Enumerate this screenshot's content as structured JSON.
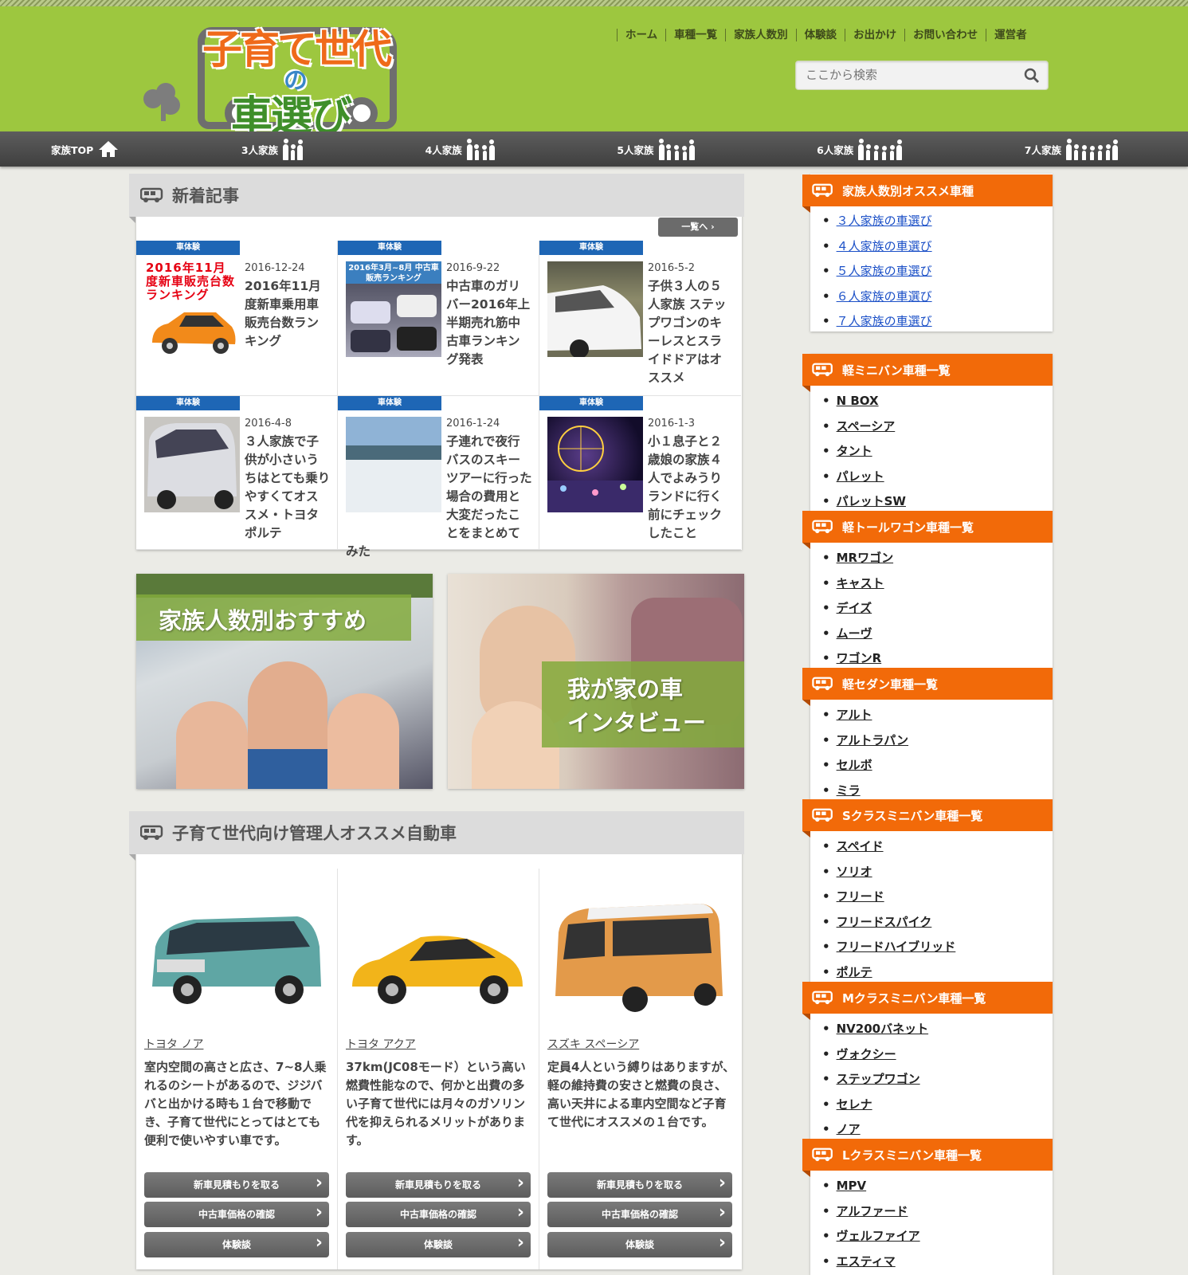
{
  "header": {
    "logo": {
      "line1": "子育て世代",
      "line2": "の",
      "line3": "車選び"
    },
    "nav": [
      "ホーム",
      "車種一覧",
      "家族人数別",
      "体験談",
      "お出かけ",
      "お問い合わせ",
      "運営者"
    ],
    "search_placeholder": "ここから検索"
  },
  "family_nav": [
    {
      "label": "家族TOP",
      "icon": "home-icon"
    },
    {
      "label": "3人家族",
      "icon": "family-3-icon"
    },
    {
      "label": "4人家族",
      "icon": "family-4-icon"
    },
    {
      "label": "5人家族",
      "icon": "family-5-icon"
    },
    {
      "label": "6人家族",
      "icon": "family-6-icon"
    },
    {
      "label": "7人家族",
      "icon": "family-7-icon"
    }
  ],
  "news": {
    "title": "新着記事",
    "more": "一覧へ",
    "items": [
      {
        "tag": "車体験",
        "date": "2016-12-24",
        "title": "2016年11月度新車乗用車販売台数ランキング",
        "thumb_text": "2016年11月度新車販売台数ランキング"
      },
      {
        "tag": "車体験",
        "date": "2016-9-22",
        "title": "中古車のガリバー2016年上半期売れ筋中古車ランキング発表",
        "thumb_text": "2016年3月~8月 中古車販売ランキング"
      },
      {
        "tag": "車体験",
        "date": "2016-5-2",
        "title": "子供３人の５人家族 ステップワゴンのキーレスとスライドドアはオススメ"
      },
      {
        "tag": "車体験",
        "date": "2016-4-8",
        "title": "３人家族で子供が小さいうちはとても乗りやすくてオススメ・トヨタポルテ"
      },
      {
        "tag": "車体験",
        "date": "2016-1-24",
        "title": "子連れで夜行バスのスキーツアーに行った場合の費用と大変だったことをまとめてみた"
      },
      {
        "tag": "車体験",
        "date": "2016-1-3",
        "title": "小１息子と２歳娘の家族４人でよみうりランドに行く前にチェックしたこと"
      }
    ]
  },
  "banners": [
    {
      "title": "家族人数別おすすめ"
    },
    {
      "title_line1": "我が家の車",
      "title_line2": "インタビュー"
    }
  ],
  "recommend": {
    "title": "子育て世代向け管理人オススメ自動車",
    "cars": [
      {
        "name": "トヨタ ノア",
        "desc": "室内空間の高さと広さ、7~8人乗れるのシートがあるので、ジジババと出かける時も１台で移動でき、子育て世代にとってはとても便利で使いやすい車です。",
        "color": "#5fa6a4"
      },
      {
        "name": "トヨタ アクア",
        "desc": "37km(JC08モード）という高い燃費性能なので、何かと出費の多い子育て世代には月々のガソリン代を抑えられるメリットがあります。",
        "color": "#f2b41a"
      },
      {
        "name": "スズキ スペーシア",
        "desc": "定員4人という縛りはありますが、軽の維持費の安さと燃費の良さ、高い天井による車内空間など子育て世代にオススメの１台です。",
        "color": "#e39a4a"
      }
    ],
    "buttons": [
      "新車見積もりを取る",
      "中古車価格の確認",
      "体験談"
    ]
  },
  "sidebar": [
    {
      "title": "家族人数別オススメ車種",
      "items": [
        "３人家族の車選び",
        "４人家族の車選び",
        "５人家族の車選び",
        "６人家族の車選び",
        "７人家族の車選び"
      ]
    },
    {
      "title": "軽ミニバン車種一覧",
      "items": [
        "N BOX",
        "スペーシア",
        "タント",
        "パレット",
        "パレットSW"
      ]
    },
    {
      "title": "軽トールワゴン車種一覧",
      "items": [
        "MRワゴン",
        "キャスト",
        "デイズ",
        "ムーヴ",
        "ワゴンR"
      ]
    },
    {
      "title": "軽セダン車種一覧",
      "items": [
        "アルト",
        "アルトラパン",
        "セルボ",
        "ミラ"
      ]
    },
    {
      "title": "Sクラスミニバン車種一覧",
      "items": [
        "スペイド",
        "ソリオ",
        "フリード",
        "フリードスパイク",
        "フリードハイブリッド",
        "ポルテ"
      ]
    },
    {
      "title": "Mクラスミニバン車種一覧",
      "items": [
        "NV200バネット",
        "ヴォクシー",
        "ステップワゴン",
        "セレナ",
        "ノア"
      ]
    },
    {
      "title": "Lクラスミニバン車種一覧",
      "items": [
        "MPV",
        "アルファード",
        "ヴェルファイア",
        "エスティマ"
      ]
    }
  ],
  "colors": {
    "header_green": "#9dc73f",
    "accent_orange": "#f26a09",
    "tag_blue": "#1e66b5"
  }
}
